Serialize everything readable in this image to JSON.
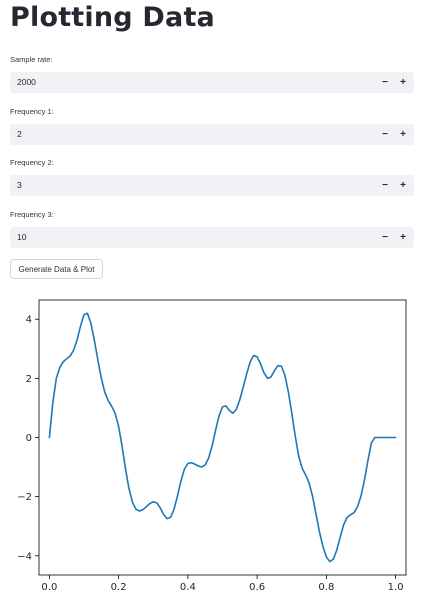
{
  "page": {
    "title": "Plotting Data"
  },
  "fields": [
    {
      "label": "Sample rate:",
      "value": "2000",
      "minus": "−",
      "plus": "+"
    },
    {
      "label": "Frequency 1:",
      "value": "2",
      "minus": "−",
      "plus": "+"
    },
    {
      "label": "Frequency 2:",
      "value": "3",
      "minus": "−",
      "plus": "+"
    },
    {
      "label": "Frequency 3:",
      "value": "10",
      "minus": "−",
      "plus": "+"
    }
  ],
  "button": {
    "label": "Generate Data & Plot"
  },
  "chart_data": {
    "type": "line",
    "title": "",
    "xlabel": "",
    "ylabel": "",
    "xlim": [
      -0.03,
      1.03
    ],
    "ylim": [
      -4.65,
      4.65
    ],
    "xticks": [
      "0.0",
      "0.2",
      "0.4",
      "0.6",
      "0.8",
      "1.0"
    ],
    "yticks": [
      "−4",
      "−2",
      "0",
      "2",
      "4"
    ],
    "grid": false,
    "color": "#1f77b4",
    "series": [
      {
        "x": [
          0,
          0.01,
          0.02,
          0.03,
          0.04,
          0.05,
          0.06,
          0.07,
          0.08,
          0.09,
          0.1,
          0.11,
          0.12,
          0.13,
          0.14,
          0.15,
          0.16,
          0.17,
          0.18,
          0.19,
          0.2,
          0.21,
          0.22,
          0.23,
          0.24,
          0.25,
          0.26,
          0.27,
          0.28,
          0.29,
          0.3,
          0.31,
          0.32,
          0.33,
          0.34,
          0.35,
          0.36,
          0.37,
          0.38,
          0.39,
          0.4,
          0.41,
          0.42,
          0.43,
          0.44,
          0.45,
          0.46,
          0.47,
          0.48,
          0.49,
          0.5,
          0.51,
          0.52,
          0.53,
          0.54,
          0.55,
          0.56,
          0.57,
          0.58,
          0.59,
          0.6,
          0.61,
          0.62,
          0.63,
          0.64,
          0.65,
          0.66,
          0.67,
          0.68,
          0.69,
          0.7,
          0.71,
          0.72,
          0.73,
          0.74,
          0.75,
          0.76,
          0.77,
          0.78,
          0.79,
          0.8,
          0.81,
          0.82,
          0.83,
          0.84,
          0.85,
          0.86,
          0.87,
          0.88,
          0.89,
          0.9,
          0.91,
          0.92,
          0.93,
          0.94,
          0.95,
          0.96,
          0.97,
          0.98,
          0.99,
          1.0
        ],
        "y": [
          0.0,
          1.185,
          2.001,
          2.365,
          2.563,
          2.661,
          2.759,
          2.953,
          3.298,
          3.768,
          4.154,
          4.2,
          3.861,
          3.279,
          2.621,
          2.004,
          1.533,
          1.24,
          1.055,
          0.81,
          0.376,
          -0.3,
          -1.068,
          -1.737,
          -2.193,
          -2.425,
          -2.486,
          -2.441,
          -2.341,
          -2.233,
          -2.172,
          -2.21,
          -2.376,
          -2.604,
          -2.745,
          -2.699,
          -2.428,
          -1.974,
          -1.466,
          -1.069,
          -0.879,
          -0.854,
          -0.9,
          -0.963,
          -0.995,
          -0.928,
          -0.693,
          -0.279,
          0.244,
          0.734,
          1.037,
          1.069,
          0.914,
          0.82,
          0.952,
          1.28,
          1.708,
          2.163,
          2.558,
          2.772,
          2.732,
          2.486,
          2.183,
          2.001,
          2.045,
          2.255,
          2.429,
          2.414,
          2.116,
          1.554,
          0.832,
          0.054,
          -0.626,
          -1.037,
          -1.262,
          -1.533,
          -1.983,
          -2.584,
          -3.189,
          -3.685,
          -4.039,
          -4.198,
          -4.115,
          -3.813,
          -3.371,
          -2.947,
          -2.7,
          -2.614,
          -2.539,
          -2.341,
          -1.98,
          -1.445,
          -0.779,
          -0.184,
          0.0,
          0.0,
          0.0,
          0.0,
          0.0,
          0.0,
          0.0
        ]
      }
    ]
  }
}
